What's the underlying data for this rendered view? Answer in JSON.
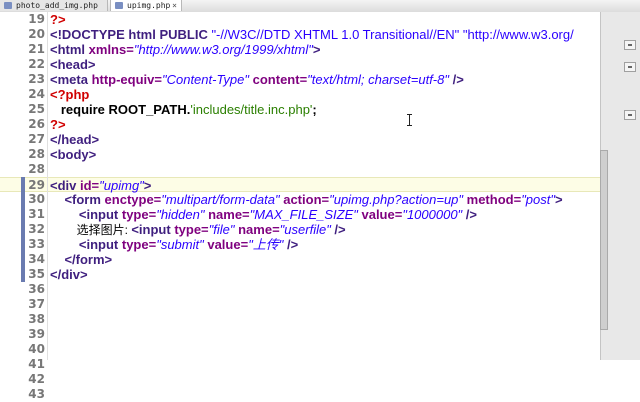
{
  "tabs": [
    {
      "label": "photo_add_img.php",
      "active": false
    },
    {
      "label": "upimg.php",
      "active": true,
      "close": "×"
    }
  ],
  "colors": {
    "tag": "#3f1f7f",
    "attribute": "#7f007f",
    "value": "#2a00ff",
    "php_delim": "#d00000",
    "php_string": "#2a7f00",
    "current_line": "#fdfde6"
  },
  "icons": {
    "file_icon": "php-file-icon",
    "cursor": "ibeam-cursor-icon"
  },
  "lines": [
    {
      "n": "19",
      "tokens": [
        {
          "c": "p",
          "t": "?>"
        }
      ]
    },
    {
      "n": "20",
      "tokens": [
        {
          "c": "d",
          "t": "<!DOCTYPE html "
        },
        {
          "c": "dk",
          "t": "PUBLIC "
        },
        {
          "c": "ds",
          "t": "\"-//W3C//DTD XHTML 1.0 Transitional//EN\" \"http://www.w3.org/"
        }
      ]
    },
    {
      "n": "21",
      "tokens": [
        {
          "c": "t",
          "t": "<html "
        },
        {
          "c": "a",
          "t": "xmlns="
        },
        {
          "c": "v",
          "t": "\"http://www.w3.org/1999/xhtml\""
        },
        {
          "c": "t",
          "t": ">"
        }
      ]
    },
    {
      "n": "22",
      "tokens": [
        {
          "c": "t",
          "t": "<head>"
        }
      ]
    },
    {
      "n": "23",
      "tokens": [
        {
          "c": "t",
          "t": "<meta "
        },
        {
          "c": "a",
          "t": "http-equiv="
        },
        {
          "c": "v",
          "t": "\"Content-Type\""
        },
        {
          "c": "a",
          "t": " content="
        },
        {
          "c": "v",
          "t": "\"text/html; charset=utf-8\""
        },
        {
          "c": "t",
          "t": " />"
        }
      ]
    },
    {
      "n": "24",
      "tokens": [
        {
          "c": "p",
          "t": "<?php"
        }
      ]
    },
    {
      "n": "25",
      "tokens": [
        {
          "c": "ph",
          "t": "   require ROOT_PATH."
        },
        {
          "c": "s",
          "t": "'includes/title.inc.php'"
        },
        {
          "c": "ph",
          "t": ";"
        }
      ]
    },
    {
      "n": "26",
      "tokens": [
        {
          "c": "p",
          "t": "?>"
        }
      ]
    },
    {
      "n": "27",
      "tokens": [
        {
          "c": "t",
          "t": "</head>"
        }
      ]
    },
    {
      "n": "28",
      "tokens": [
        {
          "c": "t",
          "t": "<body>"
        }
      ]
    },
    {
      "n": "28",
      "tokens": []
    },
    {
      "n": "29",
      "tokens": [
        {
          "c": "t",
          "t": "<div "
        },
        {
          "c": "a",
          "t": "id="
        },
        {
          "c": "v",
          "t": "\"upimg\""
        },
        {
          "c": "t",
          "t": ">"
        }
      ],
      "current": true
    },
    {
      "n": "30",
      "tokens": [
        {
          "c": "t",
          "t": "    <form "
        },
        {
          "c": "a",
          "t": "enctype="
        },
        {
          "c": "v",
          "t": "\"multipart/form-data\""
        },
        {
          "c": "a",
          "t": " action="
        },
        {
          "c": "v",
          "t": "\"upimg.php?action=up\""
        },
        {
          "c": "a",
          "t": " method="
        },
        {
          "c": "v",
          "t": "\"post\""
        },
        {
          "c": "t",
          "t": ">"
        }
      ]
    },
    {
      "n": "31",
      "tokens": [
        {
          "c": "t",
          "t": "        <input "
        },
        {
          "c": "a",
          "t": "type="
        },
        {
          "c": "v",
          "t": "\"hidden\""
        },
        {
          "c": "a",
          "t": " name="
        },
        {
          "c": "v",
          "t": "\"MAX_FILE_SIZE\""
        },
        {
          "c": "a",
          "t": " value="
        },
        {
          "c": "v",
          "t": "\"1000000\""
        },
        {
          "c": "t",
          "t": " />"
        }
      ]
    },
    {
      "n": "32",
      "tokens": [
        {
          "c": "txt",
          "t": "        选择图片: "
        },
        {
          "c": "t",
          "t": "<input "
        },
        {
          "c": "a",
          "t": "type="
        },
        {
          "c": "v",
          "t": "\"file\""
        },
        {
          "c": "a",
          "t": " name="
        },
        {
          "c": "v",
          "t": "\"userfile\""
        },
        {
          "c": "t",
          "t": " />"
        }
      ]
    },
    {
      "n": "33",
      "tokens": [
        {
          "c": "t",
          "t": "        <input "
        },
        {
          "c": "a",
          "t": "type="
        },
        {
          "c": "v",
          "t": "\"submit\""
        },
        {
          "c": "a",
          "t": " value="
        },
        {
          "c": "v",
          "t": "\"上传\""
        },
        {
          "c": "t",
          "t": " />"
        }
      ]
    },
    {
      "n": "34",
      "tokens": [
        {
          "c": "t",
          "t": "    </form>"
        }
      ]
    },
    {
      "n": "35",
      "tokens": [
        {
          "c": "t",
          "t": "</div>"
        }
      ]
    },
    {
      "n": "36",
      "tokens": []
    },
    {
      "n": "37",
      "tokens": []
    },
    {
      "n": "38",
      "tokens": []
    },
    {
      "n": "39",
      "tokens": []
    },
    {
      "n": "40",
      "tokens": []
    },
    {
      "n": "41",
      "tokens": []
    },
    {
      "n": "42",
      "tokens": []
    },
    {
      "n": "43",
      "tokens": []
    }
  ]
}
